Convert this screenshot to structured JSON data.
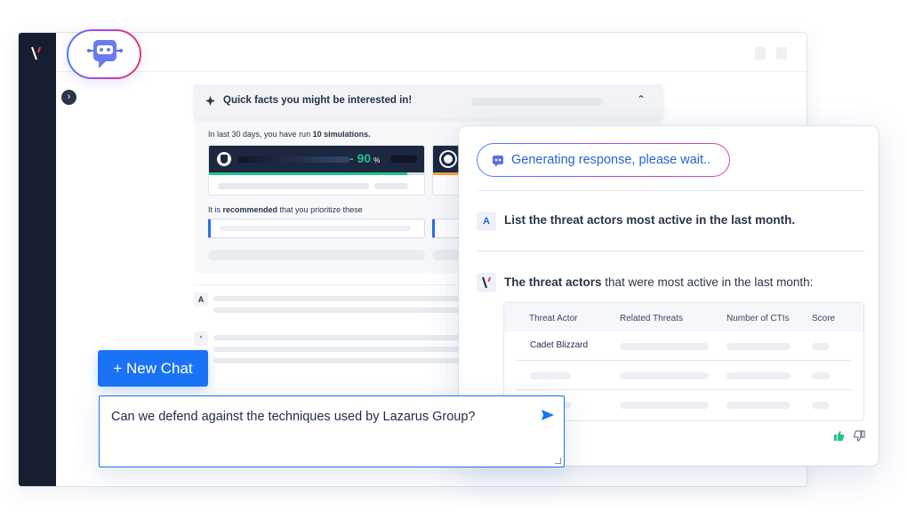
{
  "bot_badge": {
    "icon": "chatbot-icon"
  },
  "quick_facts": {
    "title": "Quick facts you might be interested in!",
    "summary_prefix": "In last 30 days, you have run ",
    "summary_bold": "10 simulations.",
    "stat_value": "90",
    "stat_unit": "%",
    "rec_prefix": "It is ",
    "rec_bold": "recommended",
    "rec_suffix": " that you prioritize these"
  },
  "history": {
    "user_initial": "A",
    "bot_initial": "ʼ"
  },
  "panel": {
    "status": "Generating response, please wait..",
    "question_avatar": "A",
    "question": "List the threat actors most active in the last month.",
    "answer_bold": "The threat actors",
    "answer_rest": " that were most active in the last month:",
    "table": {
      "headers": [
        "Threat Actor",
        "Related Threats",
        "Number of CTIs",
        "Score"
      ],
      "rows": [
        [
          "Cadet Blizzard",
          "",
          "",
          ""
        ],
        [
          "",
          "",
          "",
          ""
        ],
        [
          "",
          "",
          "",
          ""
        ]
      ]
    }
  },
  "new_chat_label": "+ New Chat",
  "chat_input": {
    "value": "Can we defend against the techniques used by Lazarus Group?"
  },
  "colors": {
    "accent": "#1a73f5",
    "rail": "#161e30",
    "positive": "#23c08a"
  }
}
